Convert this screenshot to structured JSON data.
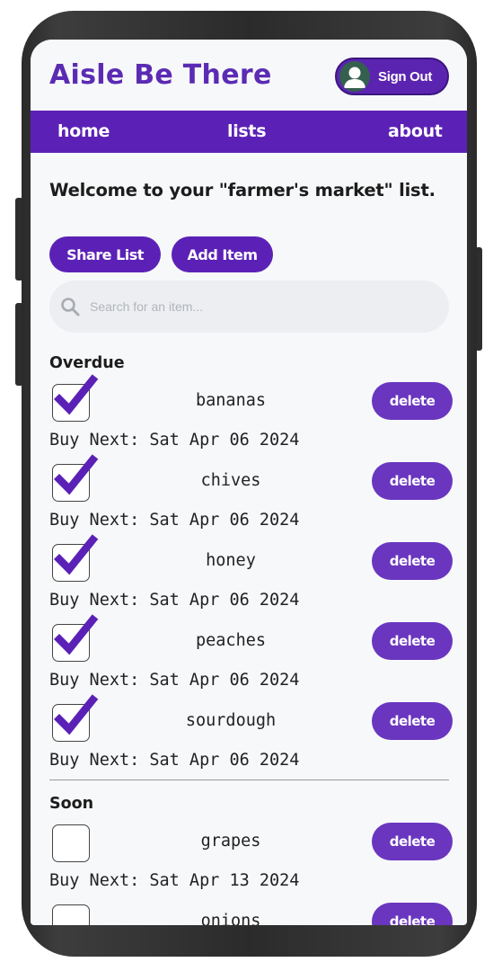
{
  "app": {
    "title": "Aisle Be There",
    "sign_out_label": "Sign Out",
    "accent": "#5b21b6"
  },
  "nav": {
    "home": "home",
    "lists": "lists",
    "about": "about"
  },
  "welcome_text": "Welcome to your \"farmer's market\" list.",
  "actions": {
    "share_label": "Share List",
    "add_label": "Add Item"
  },
  "search": {
    "placeholder": "Search for an item..."
  },
  "sections": {
    "overdue": {
      "title": "Overdue",
      "items": [
        {
          "name": "bananas",
          "checked": true,
          "buy_next": "Buy Next: Sat Apr 06 2024",
          "delete_label": "delete"
        },
        {
          "name": "chives",
          "checked": true,
          "buy_next": "Buy Next: Sat Apr 06 2024",
          "delete_label": "delete"
        },
        {
          "name": "honey",
          "checked": true,
          "buy_next": "Buy Next: Sat Apr 06 2024",
          "delete_label": "delete"
        },
        {
          "name": "peaches",
          "checked": true,
          "buy_next": "Buy Next: Sat Apr 06 2024",
          "delete_label": "delete"
        },
        {
          "name": "sourdough",
          "checked": true,
          "buy_next": "Buy Next: Sat Apr 06 2024",
          "delete_label": "delete"
        }
      ]
    },
    "soon": {
      "title": "Soon",
      "items": [
        {
          "name": "grapes",
          "checked": false,
          "buy_next": "Buy Next: Sat Apr 13 2024",
          "delete_label": "delete"
        },
        {
          "name": "onions",
          "checked": false,
          "buy_next": "",
          "delete_label": "delete"
        }
      ]
    }
  }
}
